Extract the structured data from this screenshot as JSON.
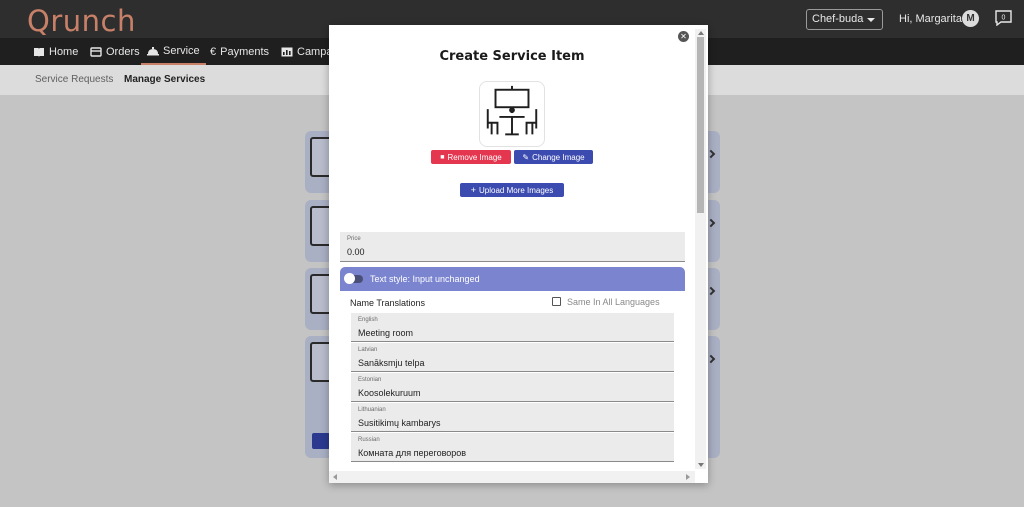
{
  "app": {
    "logo": "Qrunch"
  },
  "header": {
    "venue_select": "Chef-buda",
    "greeting": "Hi, Margarita",
    "avatar_letter": "M",
    "notification_count": "0"
  },
  "nav": {
    "items": [
      {
        "label": "Home",
        "icon": "book-icon"
      },
      {
        "label": "Orders",
        "icon": "card-icon"
      },
      {
        "label": "Service",
        "icon": "bell-icon"
      },
      {
        "label": "Payments",
        "icon": "euro-icon"
      },
      {
        "label": "Campa",
        "icon": "chart-icon"
      }
    ],
    "active": "Service"
  },
  "subnav": {
    "items": [
      "Service Requests",
      "Manage Services"
    ],
    "active": "Manage Services"
  },
  "modal": {
    "title": "Create Service Item",
    "image_icon": "meeting-room-icon",
    "remove_image": "Remove Image",
    "change_image": "Change Image",
    "upload_more": "Upload More Images",
    "price": {
      "label": "Price",
      "value": "0.00"
    },
    "text_style": "Text style: Input unchanged",
    "translations": {
      "header": "Name Translations",
      "same_label": "Same In All Languages",
      "fields": [
        {
          "label": "English",
          "value": "Meeting room"
        },
        {
          "label": "Latvian",
          "value": "Sanāksmju telpa"
        },
        {
          "label": "Estonian",
          "value": "Koosolekuruum"
        },
        {
          "label": "Lithuanian",
          "value": "Susitikimų kambarys"
        },
        {
          "label": "Russian",
          "value": "Комната для переговоров"
        }
      ]
    }
  },
  "colors": {
    "accent": "#c88068",
    "primary": "#3b4bb0",
    "danger": "#e5364f",
    "style_bar": "#7b84cf"
  }
}
